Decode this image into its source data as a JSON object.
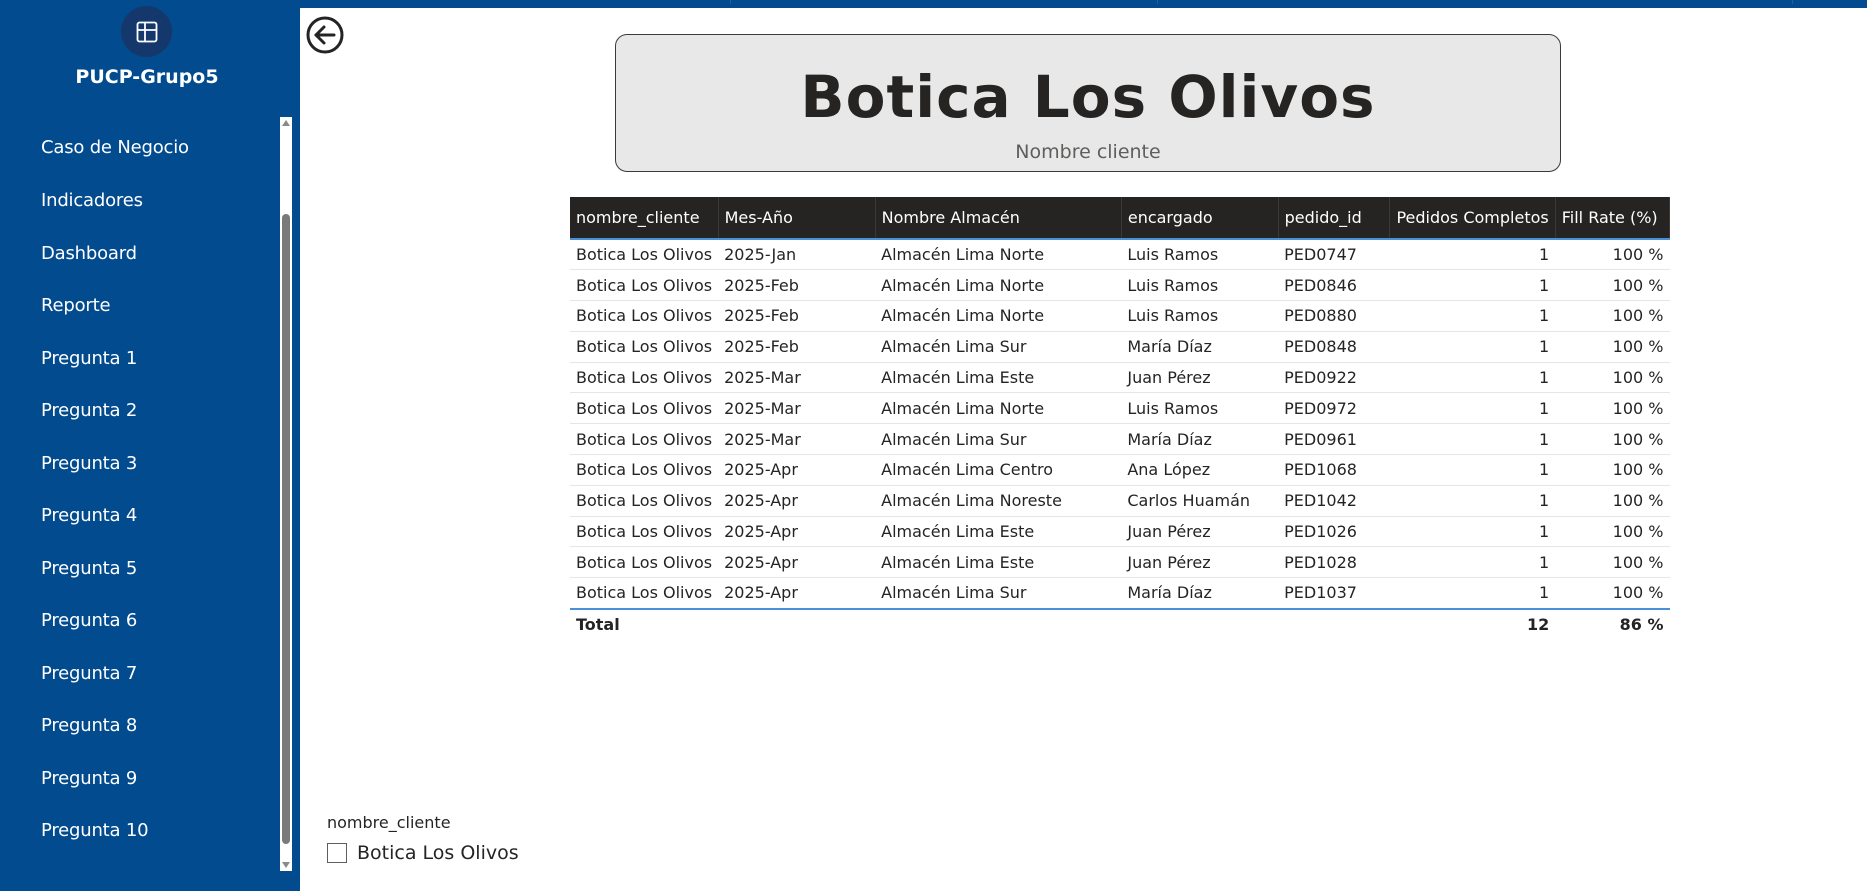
{
  "sidebar": {
    "workspace_name": "PUCP-Grupo5",
    "items": [
      {
        "label": "Caso de Negocio"
      },
      {
        "label": "Indicadores"
      },
      {
        "label": "Dashboard"
      },
      {
        "label": "Reporte"
      },
      {
        "label": "Pregunta 1"
      },
      {
        "label": "Pregunta 2"
      },
      {
        "label": "Pregunta 3"
      },
      {
        "label": "Pregunta 4"
      },
      {
        "label": "Pregunta 5"
      },
      {
        "label": "Pregunta 6"
      },
      {
        "label": "Pregunta 7"
      },
      {
        "label": "Pregunta 8"
      },
      {
        "label": "Pregunta 9"
      },
      {
        "label": "Pregunta 10"
      }
    ]
  },
  "card": {
    "title": "Botica Los Olivos",
    "subtitle": "Nombre cliente"
  },
  "table": {
    "headers": [
      "nombre_cliente",
      "Mes-Año",
      "Nombre Almacén",
      "encargado",
      "pedido_id",
      "Pedidos Completos",
      "Fill Rate (%)"
    ],
    "rows": [
      [
        "Botica Los Olivos",
        "2025-Jan",
        "Almacén Lima Norte",
        "Luis Ramos",
        "PED0747",
        "1",
        "100 %"
      ],
      [
        "Botica Los Olivos",
        "2025-Feb",
        "Almacén Lima Norte",
        "Luis Ramos",
        "PED0846",
        "1",
        "100 %"
      ],
      [
        "Botica Los Olivos",
        "2025-Feb",
        "Almacén Lima Norte",
        "Luis Ramos",
        "PED0880",
        "1",
        "100 %"
      ],
      [
        "Botica Los Olivos",
        "2025-Feb",
        "Almacén Lima Sur",
        "María Díaz",
        "PED0848",
        "1",
        "100 %"
      ],
      [
        "Botica Los Olivos",
        "2025-Mar",
        "Almacén Lima Este",
        "Juan Pérez",
        "PED0922",
        "1",
        "100 %"
      ],
      [
        "Botica Los Olivos",
        "2025-Mar",
        "Almacén Lima Norte",
        "Luis Ramos",
        "PED0972",
        "1",
        "100 %"
      ],
      [
        "Botica Los Olivos",
        "2025-Mar",
        "Almacén Lima Sur",
        "María Díaz",
        "PED0961",
        "1",
        "100 %"
      ],
      [
        "Botica Los Olivos",
        "2025-Apr",
        "Almacén Lima Centro",
        "Ana López",
        "PED1068",
        "1",
        "100 %"
      ],
      [
        "Botica Los Olivos",
        "2025-Apr",
        "Almacén Lima Noreste",
        "Carlos Huamán",
        "PED1042",
        "1",
        "100 %"
      ],
      [
        "Botica Los Olivos",
        "2025-Apr",
        "Almacén Lima Este",
        "Juan Pérez",
        "PED1026",
        "1",
        "100 %"
      ],
      [
        "Botica Los Olivos",
        "2025-Apr",
        "Almacén Lima Este",
        "Juan Pérez",
        "PED1028",
        "1",
        "100 %"
      ],
      [
        "Botica Los Olivos",
        "2025-Apr",
        "Almacén Lima Sur",
        "María Díaz",
        "PED1037",
        "1",
        "100 %"
      ]
    ],
    "total": {
      "label": "Total",
      "pedidos_completos": "12",
      "fill_rate": "86 %"
    }
  },
  "slicer": {
    "title": "nombre_cliente",
    "options": [
      {
        "label": "Botica Los Olivos",
        "checked": false
      }
    ]
  },
  "colors": {
    "sidebar_bg": "#024b8f",
    "table_header_bg": "#252423",
    "accent_line": "#4a90d9",
    "card_bg": "#e8e8e8"
  },
  "icons": {
    "workspace": "workspace-report-icon",
    "back": "back-arrow-icon"
  }
}
